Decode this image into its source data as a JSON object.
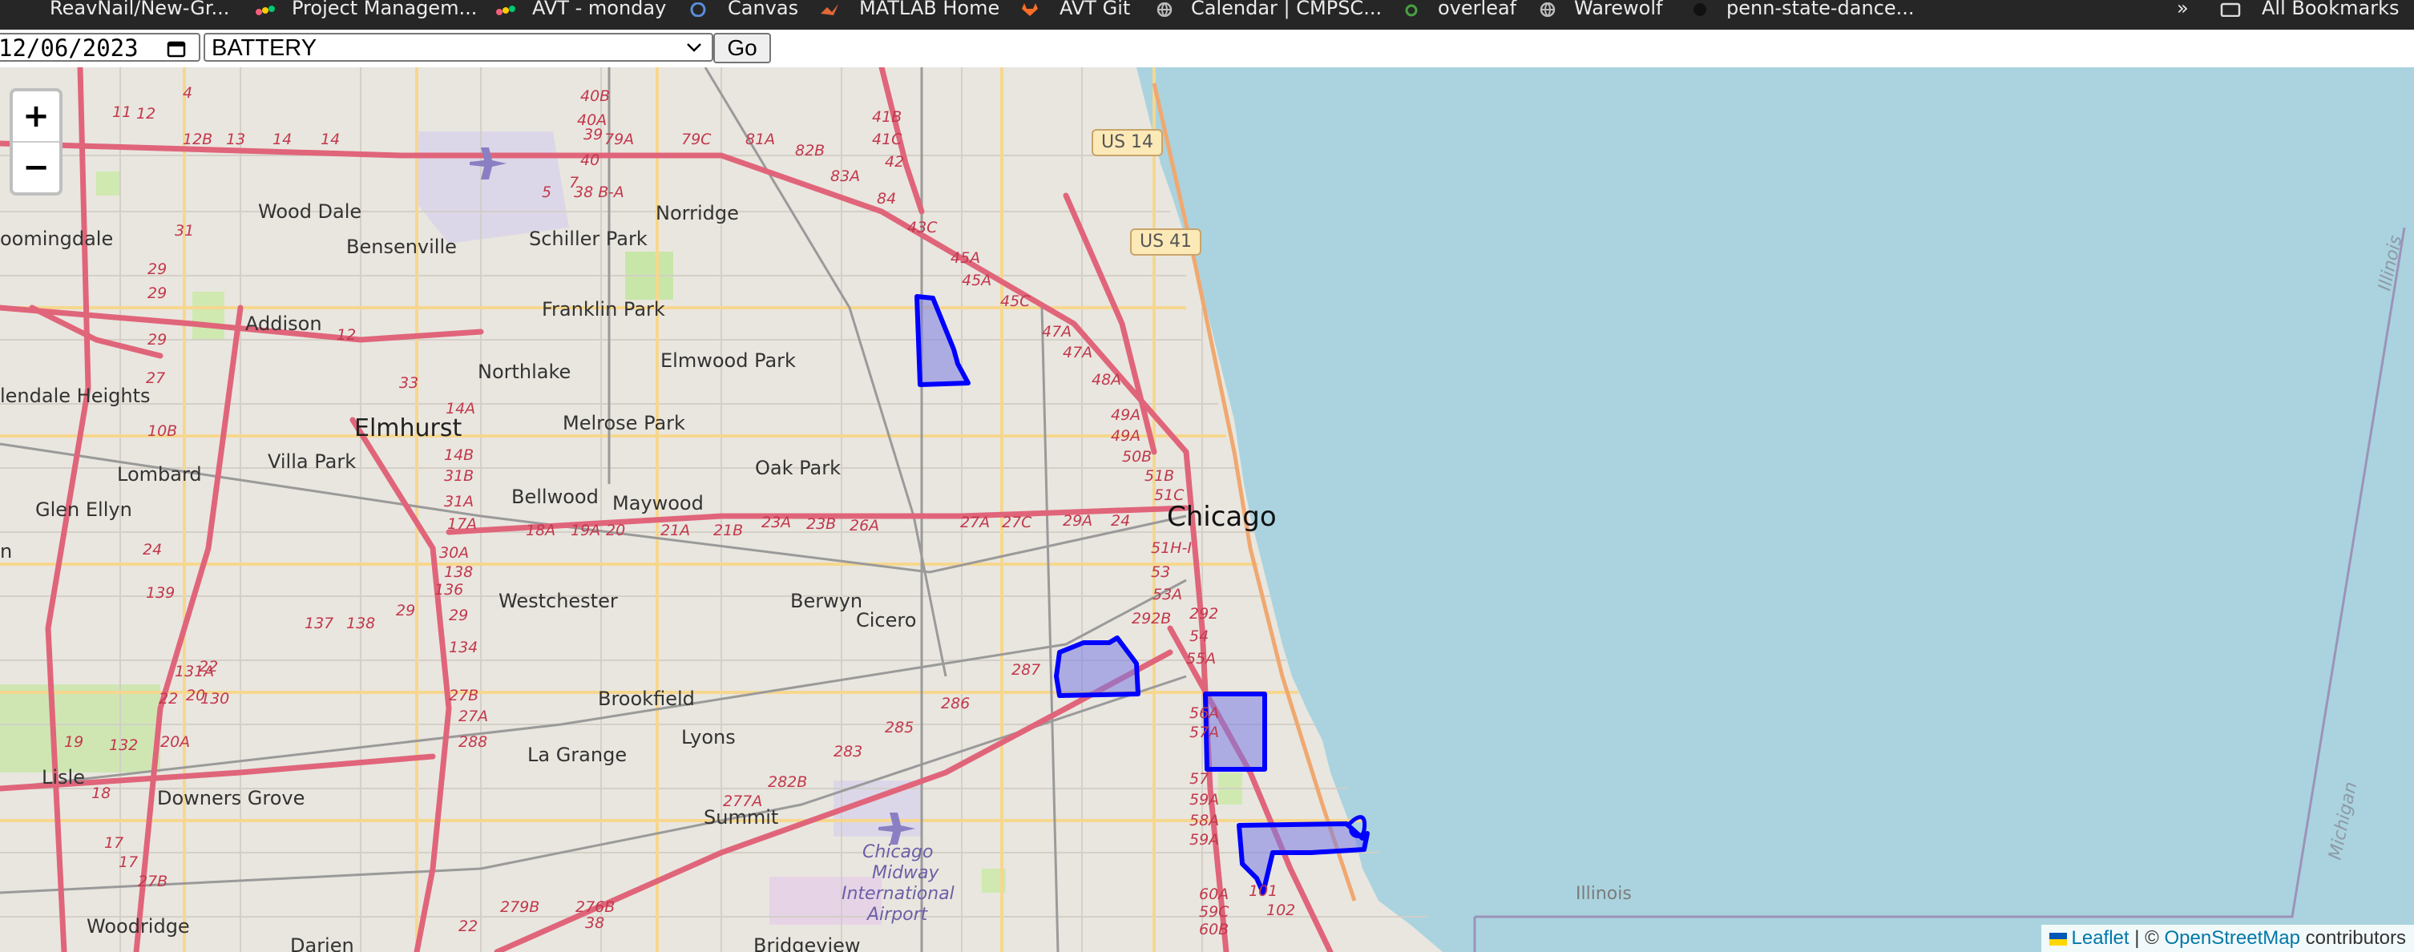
{
  "bookmarks": {
    "items": [
      {
        "label": "ReavNail/New-Gr...",
        "icon": "github-icon"
      },
      {
        "label": "Project Managem...",
        "icon": "monday-icon"
      },
      {
        "label": "AVT - monday",
        "icon": "monday-icon"
      },
      {
        "label": "Canvas",
        "icon": "canvas-icon"
      },
      {
        "label": "MATLAB Home",
        "icon": "matlab-icon"
      },
      {
        "label": "AVT Git",
        "icon": "gitlab-icon"
      },
      {
        "label": "Calendar | CMPSC...",
        "icon": "globe-icon"
      },
      {
        "label": "overleaf",
        "icon": "overleaf-icon"
      },
      {
        "label": "Warewolf",
        "icon": "globe-icon"
      },
      {
        "label": "penn-state-dance...",
        "icon": "github-icon"
      }
    ],
    "overflow": "»",
    "all_bookmarks": "All Bookmarks"
  },
  "form": {
    "date_value": "12/06/2023",
    "select_value": "BATTERY",
    "go_label": "Go"
  },
  "map": {
    "zoom_in": "+",
    "zoom_out": "−",
    "places": {
      "elmhurst": "Elmhurst",
      "chicago": "Chicago",
      "wood_dale": "Wood Dale",
      "bensenville": "Bensenville",
      "schiller_park": "Schiller Park",
      "norridge": "Norridge",
      "bloomingdale": "oomingdale",
      "addison": "Addison",
      "franklin_park": "Franklin Park",
      "elmwood_park": "Elmwood Park",
      "northlake": "Northlake",
      "melrose_park": "Melrose Park",
      "glendale_heights": "lendale Heights",
      "villa_park": "Villa Park",
      "oak_park": "Oak Park",
      "lombard": "Lombard",
      "bellwood": "Bellwood",
      "maywood": "Maywood",
      "glen_ellyn": "Glen Ellyn",
      "westchester": "Westchester",
      "berwyn": "Berwyn",
      "cicero": "Cicero",
      "brookfield": "Brookfield",
      "la_grange": "La Grange",
      "lyons": "Lyons",
      "lisle": "Lisle",
      "downers_grove": "Downers Grove",
      "summit": "Summit",
      "woodridge": "Woodridge",
      "darien": "Darien",
      "bridgeview": "Bridgeview",
      "illinois": "Illinois",
      "illinois_line": "Illinois",
      "michigan": "Michigan",
      "edge_le": "le",
      "edge_n": "n",
      "midway": [
        "Chicago",
        "Midway",
        "International",
        "Airport"
      ]
    },
    "shields": [
      "US 14",
      "US 41"
    ],
    "exit_labels": [
      "11",
      "12",
      "4",
      "12B",
      "13",
      "14",
      "14",
      "40B",
      "40A",
      "41B",
      "41C",
      "42",
      "79A",
      "79C",
      "81A",
      "82B",
      "83A",
      "84",
      "43C",
      "45A",
      "45A",
      "45C",
      "47A",
      "47A",
      "48A",
      "49A",
      "49A",
      "50B",
      "51B",
      "51C",
      "51H-I",
      "53",
      "53A",
      "292B",
      "292",
      "54",
      "55A",
      "56A",
      "57A",
      "57",
      "59A",
      "58A",
      "59A",
      "60A",
      "59C",
      "60B",
      "101",
      "102",
      "31",
      "29",
      "29",
      "29",
      "27",
      "10B",
      "12",
      "33",
      "14A",
      "14B",
      "31B",
      "31A",
      "17A",
      "18A",
      "19A",
      "20",
      "21A",
      "21B",
      "23A",
      "23B",
      "26A",
      "27A",
      "27C",
      "29A",
      "24",
      "24",
      "139",
      "30A",
      "138",
      "136",
      "137",
      "138",
      "29",
      "29",
      "134",
      "22",
      "131A",
      "20",
      "22",
      "130",
      "19",
      "132",
      "20A",
      "18",
      "17",
      "17",
      "27B",
      "27B",
      "27A",
      "288",
      "287",
      "286",
      "285",
      "283",
      "282B",
      "277A",
      "279B",
      "276B",
      "22",
      "38",
      "39",
      "40",
      "38 B-A",
      "5",
      "7"
    ],
    "attribution": {
      "leaflet": "Leaflet",
      "sep": " | © ",
      "osm": "OpenStreetMap",
      "suffix": " contributors"
    },
    "colors": {
      "land": "#e9e6df",
      "lake": "#aad3df",
      "highway": "#e0657a",
      "polygon_stroke": "#0000ff",
      "polygon_fill": "#7a7ce6"
    }
  }
}
